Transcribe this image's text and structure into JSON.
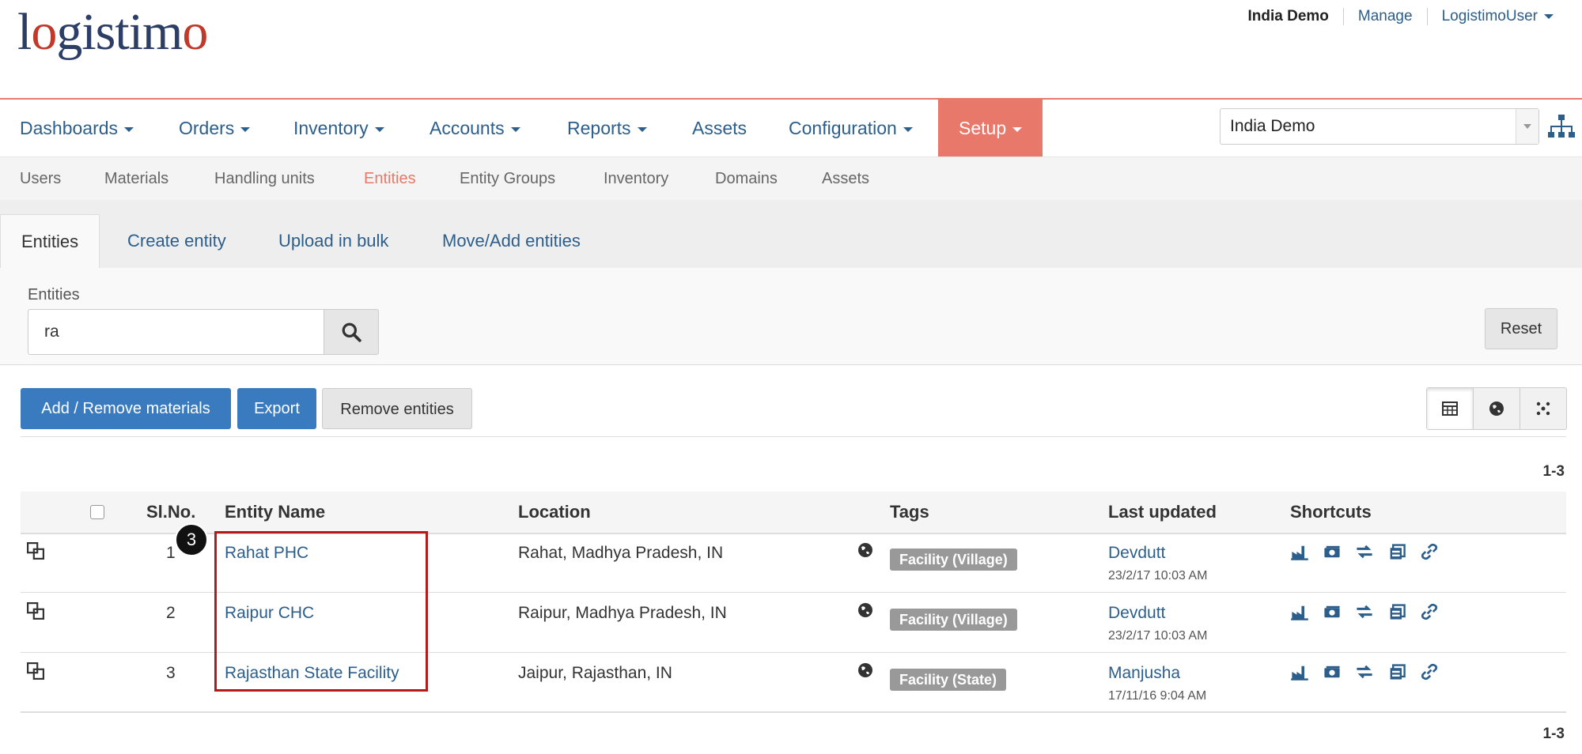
{
  "header": {
    "logo": "logistimo",
    "domain_name": "India Demo",
    "manage": "Manage",
    "user": "LogistimoUser"
  },
  "mainnav": {
    "items": [
      "Dashboards",
      "Orders",
      "Inventory",
      "Accounts",
      "Reports",
      "Assets",
      "Configuration",
      "Setup"
    ],
    "domain_select": "India Demo"
  },
  "subnav": {
    "items": [
      "Users",
      "Materials",
      "Handling units",
      "Entities",
      "Entity Groups",
      "Inventory",
      "Domains",
      "Assets"
    ]
  },
  "tabs": [
    "Entities",
    "Create entity",
    "Upload in bulk",
    "Move/Add entities"
  ],
  "filter": {
    "label": "Entities",
    "search_value": "ra",
    "reset": "Reset"
  },
  "actions": {
    "add_remove": "Add / Remove materials",
    "export": "Export",
    "remove": "Remove entities"
  },
  "pager": "1-3",
  "table": {
    "headers": [
      "Sl.No.",
      "Entity Name",
      "Location",
      "Tags",
      "Last updated",
      "Shortcuts"
    ],
    "rows": [
      {
        "no": "1",
        "name": "Rahat PHC",
        "location": "Rahat, Madhya Pradesh, IN",
        "tag": "Facility (Village)",
        "updated_by": "Devdutt",
        "updated_at": "23/2/17 10:03 AM"
      },
      {
        "no": "2",
        "name": "Raipur CHC",
        "location": "Raipur, Madhya Pradesh, IN",
        "tag": "Facility (Village)",
        "updated_by": "Devdutt",
        "updated_at": "23/2/17 10:03 AM"
      },
      {
        "no": "3",
        "name": "Rajasthan State Facility",
        "location": "Jaipur, Rajasthan, IN",
        "tag": "Facility (State)",
        "updated_by": "Manjusha",
        "updated_at": "17/11/16 9:04 AM"
      }
    ]
  },
  "annotation": {
    "step": "3"
  },
  "colors": {
    "accent": "#e8786a",
    "link": "#2c5e8c",
    "primary_button": "#3a7bbf",
    "highlight": "#b31b1b"
  }
}
